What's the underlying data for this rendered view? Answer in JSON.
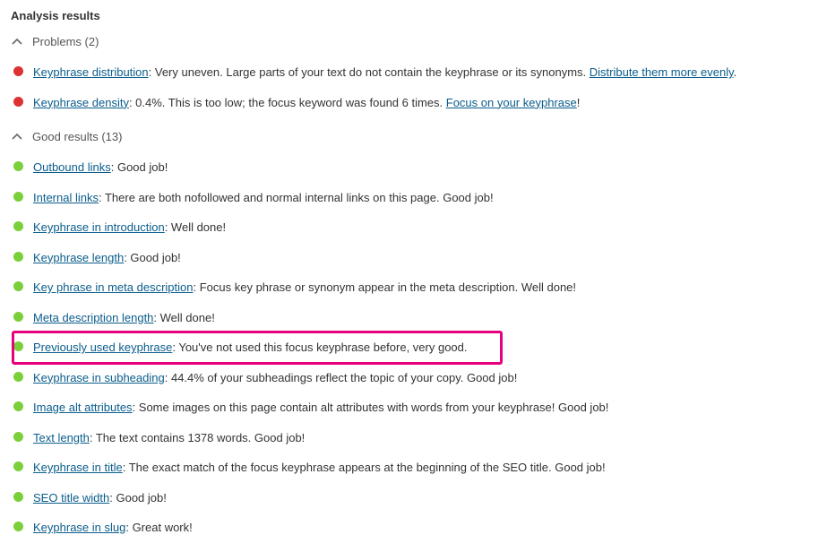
{
  "title": "Analysis results",
  "sections": {
    "problems": {
      "label": "Problems (2)",
      "items": [
        {
          "status": "red",
          "label": "Keyphrase distribution",
          "text": ": Very uneven. Large parts of your text do not contain the keyphrase or its synonyms. ",
          "action_label": "Distribute them more evenly",
          "tail": "."
        },
        {
          "status": "red",
          "label": "Keyphrase density",
          "text": ": 0.4%. This is too low; the focus keyword was found 6 times. ",
          "action_label": "Focus on your keyphrase",
          "tail": "!"
        }
      ]
    },
    "good": {
      "label": "Good results (13)",
      "items": [
        {
          "status": "green",
          "label": "Outbound links",
          "text": ": Good job!"
        },
        {
          "status": "green",
          "label": "Internal links",
          "text": ": There are both nofollowed and normal internal links on this page. Good job!"
        },
        {
          "status": "green",
          "label": "Keyphrase in introduction",
          "text": ": Well done!"
        },
        {
          "status": "green",
          "label": "Keyphrase length",
          "text": ": Good job!"
        },
        {
          "status": "green",
          "label": "Key phrase in meta description",
          "text": ": Focus key phrase or synonym appear in the meta description. Well done!"
        },
        {
          "status": "green",
          "label": "Meta description length",
          "text": ": Well done!"
        },
        {
          "status": "green",
          "label": "Previously used keyphrase",
          "text": ": You've not used this focus keyphrase before, very good.",
          "highlight": true
        },
        {
          "status": "green",
          "label": "Keyphrase in subheading",
          "text": ": 44.4% of your subheadings reflect the topic of your copy. Good job!"
        },
        {
          "status": "green",
          "label": "Image alt attributes",
          "text": ": Some images on this page contain alt attributes with words from your keyphrase! Good job!"
        },
        {
          "status": "green",
          "label": "Text length",
          "text": ": The text contains 1378 words. Good job!"
        },
        {
          "status": "green",
          "label": "Keyphrase in title",
          "text": ": The exact match of the focus keyphrase appears at the beginning of the SEO title. Good job!"
        },
        {
          "status": "green",
          "label": "SEO title width",
          "text": ": Good job!"
        },
        {
          "status": "green",
          "label": "Keyphrase in slug",
          "text": ": Great work!"
        }
      ]
    }
  }
}
